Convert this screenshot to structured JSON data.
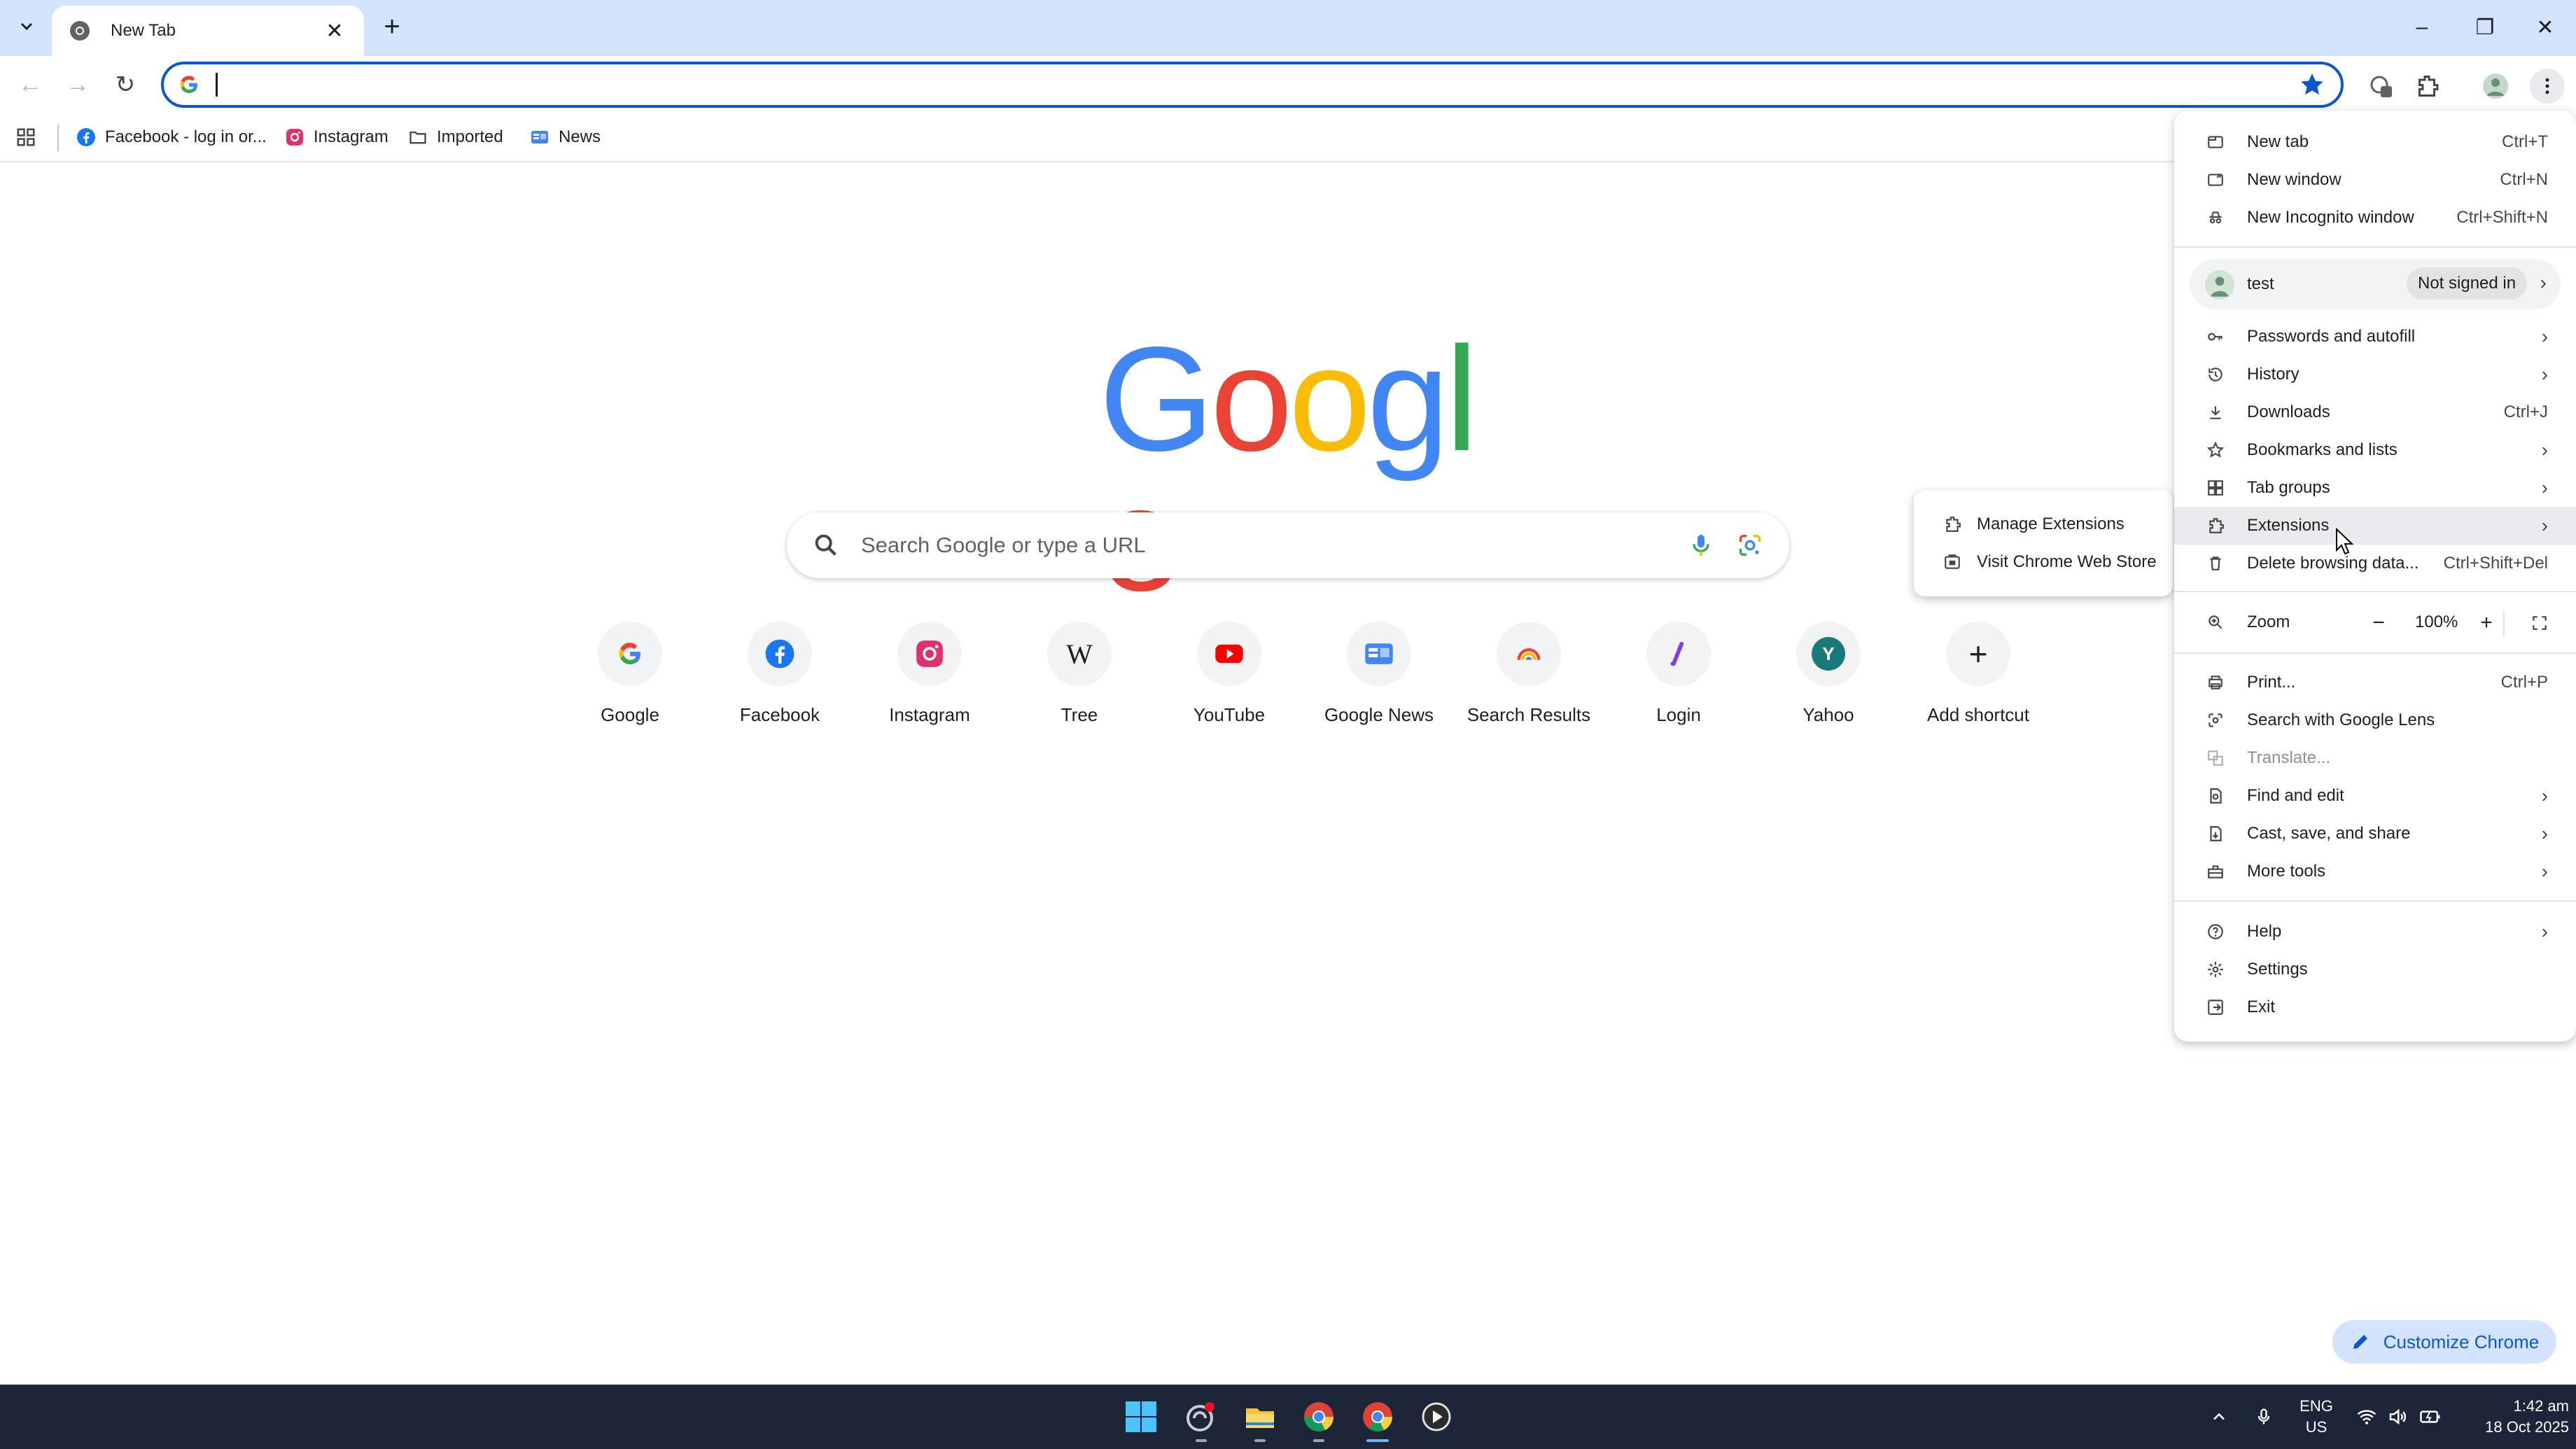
{
  "browser": {
    "tab_title": "New Tab",
    "close_tab_glyph": "✕",
    "new_tab_glyph": "+",
    "window_controls": {
      "minimize": "–",
      "restore": "❐",
      "close": "✕"
    }
  },
  "toolbar": {
    "back_glyph": "←",
    "forward_glyph": "→",
    "reload_glyph": "↻",
    "omnibox_value": "",
    "icons": [
      "star-icon",
      "extension-badge-icon",
      "puzzle-extensions-icon",
      "profile-avatar-icon",
      "kebab-menu-icon"
    ],
    "ext_badge_count": "0"
  },
  "bookmarks": [
    {
      "label": "Facebook - log in or...",
      "icon": "facebook-icon"
    },
    {
      "label": "Instagram",
      "icon": "instagram-icon"
    },
    {
      "label": "Imported",
      "icon": "folder-icon"
    },
    {
      "label": "News",
      "icon": "google-news-icon"
    }
  ],
  "ntp": {
    "logo_letters": [
      "G",
      "o",
      "o",
      "g",
      "l",
      "e"
    ],
    "logo_colors": [
      "#4285f4",
      "#ea4335",
      "#fbbc05",
      "#4285f4",
      "#34a853",
      "#ea4335"
    ],
    "search_placeholder": "Search Google or type a URL",
    "shortcuts": [
      {
        "label": "Google",
        "icon": "google-icon"
      },
      {
        "label": "Facebook",
        "icon": "facebook-icon"
      },
      {
        "label": "Instagram",
        "icon": "instagram-icon"
      },
      {
        "label": "Tree",
        "icon": "wikipedia-icon",
        "glyph": "W"
      },
      {
        "label": "YouTube",
        "icon": "youtube-icon"
      },
      {
        "label": "Google News",
        "icon": "google-news-icon"
      },
      {
        "label": "Search Results",
        "icon": "search-results-icon"
      },
      {
        "label": "Login",
        "icon": "login-icon"
      },
      {
        "label": "Yahoo",
        "icon": "yahoo-icon",
        "glyph": "Y"
      },
      {
        "label": "Add shortcut",
        "icon": "plus-icon",
        "glyph": "+"
      }
    ],
    "customize_label": "Customize Chrome"
  },
  "menu": {
    "new_tab": {
      "label": "New tab",
      "shortcut": "Ctrl+T"
    },
    "new_window": {
      "label": "New window",
      "shortcut": "Ctrl+N"
    },
    "new_incognito": {
      "label": "New Incognito window",
      "shortcut": "Ctrl+Shift+N"
    },
    "profile": {
      "name": "test",
      "status": "Not signed in"
    },
    "passwords": {
      "label": "Passwords and autofill"
    },
    "history": {
      "label": "History"
    },
    "downloads": {
      "label": "Downloads",
      "shortcut": "Ctrl+J"
    },
    "bookmarks": {
      "label": "Bookmarks and lists"
    },
    "tab_groups": {
      "label": "Tab groups"
    },
    "extensions": {
      "label": "Extensions"
    },
    "delete_data": {
      "label": "Delete browsing data...",
      "shortcut": "Ctrl+Shift+Del"
    },
    "zoom": {
      "label": "Zoom",
      "minus": "−",
      "value": "100%",
      "plus": "+"
    },
    "print": {
      "label": "Print...",
      "shortcut": "Ctrl+P"
    },
    "lens": {
      "label": "Search with Google Lens"
    },
    "translate": {
      "label": "Translate..."
    },
    "find_edit": {
      "label": "Find and edit"
    },
    "cast_save": {
      "label": "Cast, save, and share"
    },
    "more_tools": {
      "label": "More tools"
    },
    "help": {
      "label": "Help"
    },
    "settings": {
      "label": "Settings"
    },
    "exit": {
      "label": "Exit"
    },
    "arrow": "›"
  },
  "extensions_submenu": {
    "manage": "Manage Extensions",
    "store": "Visit Chrome Web Store"
  },
  "taskbar": {
    "apps": [
      "windows-start-icon",
      "app-red-dot-icon",
      "file-explorer-icon",
      "chrome-icon",
      "chrome-active-icon",
      "media-player-icon"
    ],
    "lang_top": "ENG",
    "lang_bottom": "US",
    "time": "1:42 am",
    "date": "18 Oct 2025"
  }
}
